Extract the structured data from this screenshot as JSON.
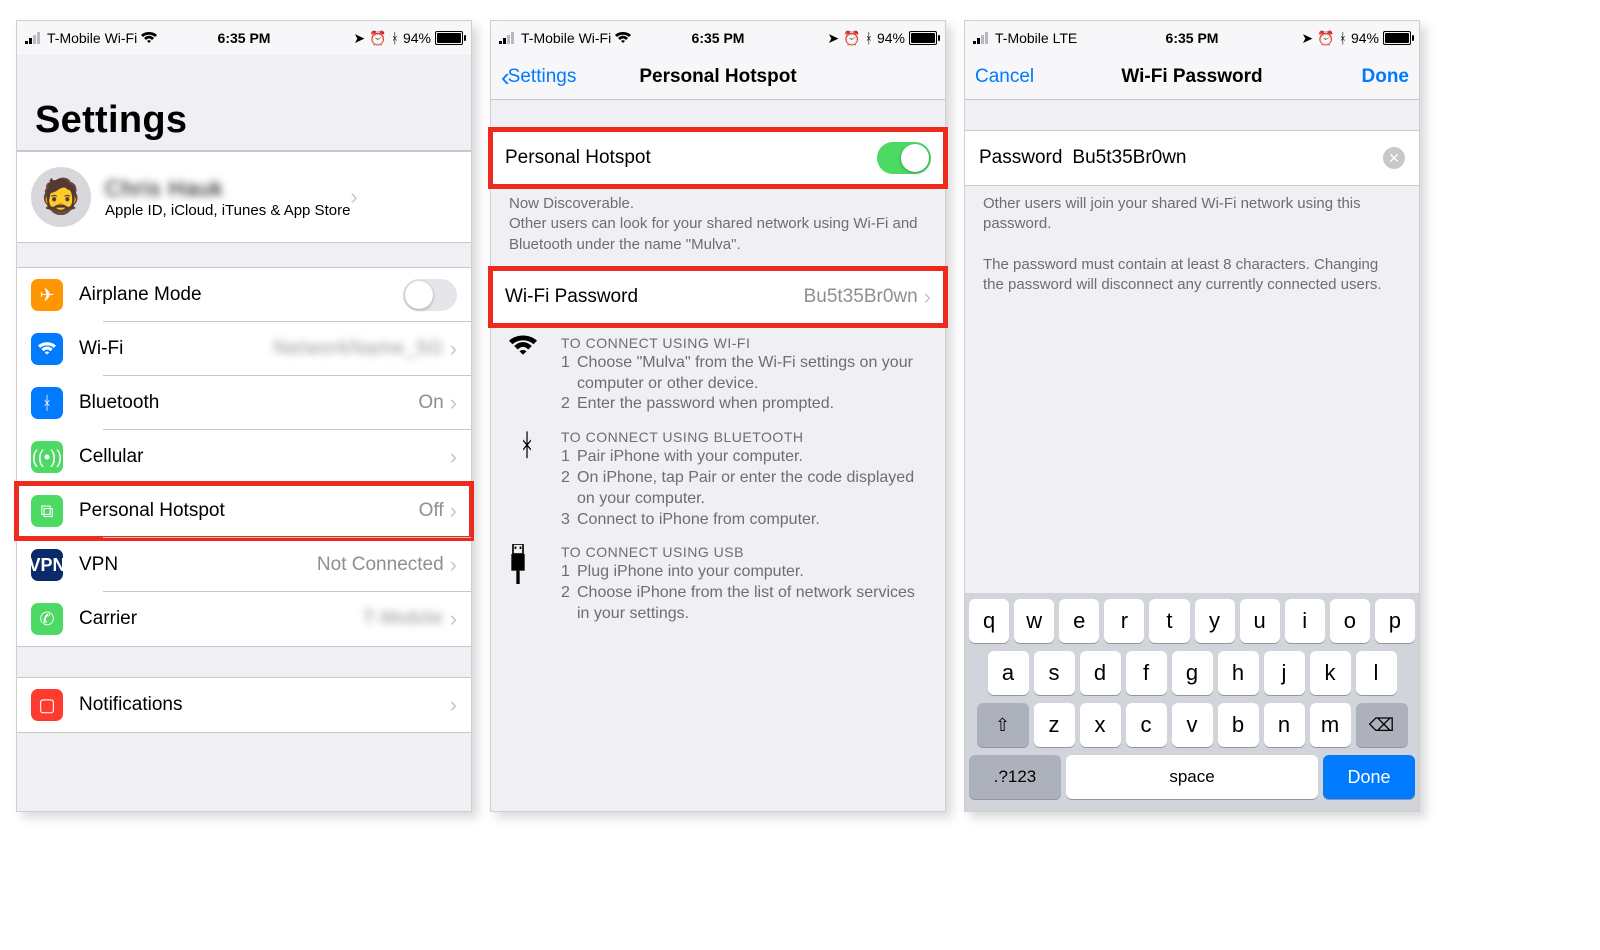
{
  "status": {
    "carrier_wifi": "T-Mobile Wi-Fi",
    "carrier_lte": "T-Mobile  LTE",
    "time": "6:35 PM",
    "battery": "94%"
  },
  "s1": {
    "title": "Settings",
    "profile_sub": "Apple ID, iCloud, iTunes & App Store",
    "items": {
      "airplane": "Airplane Mode",
      "wifi": "Wi-Fi",
      "bt": "Bluetooth",
      "bt_val": "On",
      "cell": "Cellular",
      "hotspot": "Personal Hotspot",
      "hotspot_val": "Off",
      "vpn": "VPN",
      "vpn_val": "Not Connected",
      "carrier": "Carrier",
      "notif": "Notifications"
    }
  },
  "s2": {
    "back": "Settings",
    "title": "Personal Hotspot",
    "row_hotspot": "Personal Hotspot",
    "discover": "Now Discoverable.",
    "discover2": "Other users can look for your shared network using Wi-Fi and Bluetooth under the name \"Mulva\".",
    "pw_label": "Wi-Fi Password",
    "pw_value": "Bu5t35Br0wn",
    "wifi_head": "TO CONNECT USING WI-FI",
    "wifi_1": "Choose \"Mulva\" from the Wi-Fi settings on your computer or other device.",
    "wifi_2": "Enter the password when prompted.",
    "bt_head": "TO CONNECT USING BLUETOOTH",
    "bt_1": "Pair iPhone with your computer.",
    "bt_2": "On iPhone, tap Pair or enter the code displayed on your computer.",
    "bt_3": "Connect to iPhone from computer.",
    "usb_head": "TO CONNECT USING USB",
    "usb_1": "Plug iPhone into your computer.",
    "usb_2": "Choose iPhone from the list of network services in your settings."
  },
  "s3": {
    "cancel": "Cancel",
    "title": "Wi-Fi Password",
    "done_nav": "Done",
    "field_label": "Password",
    "field_value": "Bu5t35Br0wn",
    "note1": "Other users will join your shared Wi-Fi network using this password.",
    "note2": "The password must contain at least 8 characters. Changing the password will disconnect any currently connected users.",
    "kbd": {
      "r1": [
        "q",
        "w",
        "e",
        "r",
        "t",
        "y",
        "u",
        "i",
        "o",
        "p"
      ],
      "r2": [
        "a",
        "s",
        "d",
        "f",
        "g",
        "h",
        "j",
        "k",
        "l"
      ],
      "r3": [
        "z",
        "x",
        "c",
        "v",
        "b",
        "n",
        "m"
      ],
      "num": ".?123",
      "space": "space",
      "done": "Done"
    }
  }
}
